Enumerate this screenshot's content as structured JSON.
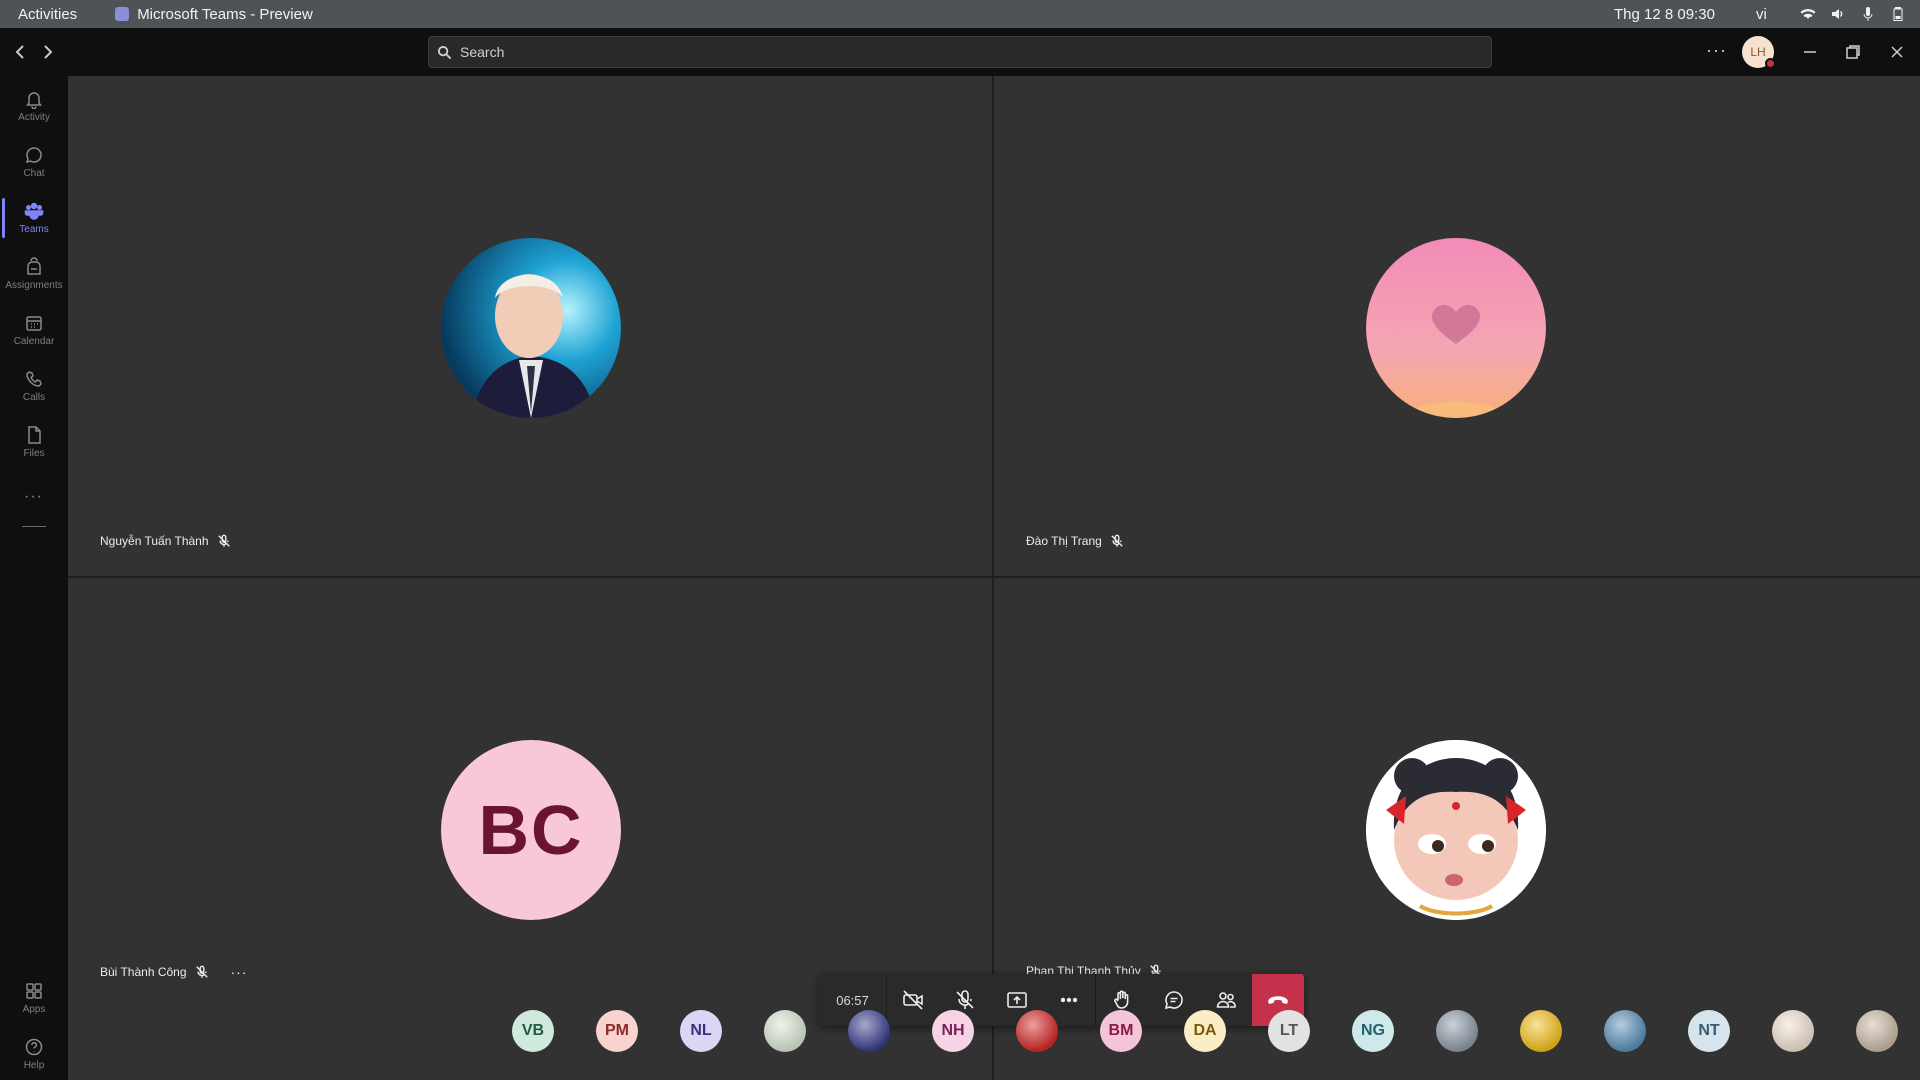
{
  "system_bar": {
    "activities": "Activities",
    "app_title": "Microsoft Teams - Preview",
    "clock": "Thg 12 8  09:30",
    "language": "vi"
  },
  "titlebar": {
    "search_placeholder": "Search",
    "more": "···",
    "avatar_initials": "LH"
  },
  "rail": {
    "items": [
      {
        "label": "Activity",
        "icon": "bell-icon"
      },
      {
        "label": "Chat",
        "icon": "chat-icon"
      },
      {
        "label": "Teams",
        "icon": "teams-icon",
        "active": true
      },
      {
        "label": "Assignments",
        "icon": "backpack-icon"
      },
      {
        "label": "Calendar",
        "icon": "calendar-icon"
      },
      {
        "label": "Calls",
        "icon": "phone-icon"
      },
      {
        "label": "Files",
        "icon": "file-icon"
      }
    ],
    "more": "···",
    "bottom_items": [
      {
        "label": "Apps",
        "icon": "apps-icon"
      },
      {
        "label": "Help",
        "icon": "help-icon"
      }
    ]
  },
  "participants": [
    {
      "name": "Nguyễn Tuấn Thành",
      "muted": true,
      "avatar": "photo"
    },
    {
      "name": "Đào Thị Trang",
      "muted": true,
      "avatar": "photo"
    },
    {
      "name": "Bùi Thành Công",
      "muted": true,
      "avatar_initials": "BC",
      "more": "···"
    },
    {
      "name": "Phan Thị Thanh Thủy",
      "muted": true,
      "avatar": "photo"
    }
  ],
  "call_controls": {
    "timer": "06:57"
  },
  "strip": [
    {
      "initials": "VB",
      "bg": "#cfe9dd",
      "fg": "#1d5e44"
    },
    {
      "initials": "PM",
      "bg": "#f9d3cf",
      "fg": "#8a2b24"
    },
    {
      "initials": "NL",
      "bg": "#dcd5f3",
      "fg": "#3e2f7f"
    },
    {
      "initials": "",
      "bg": "#d9e6d3",
      "photo": true
    },
    {
      "initials": "",
      "bg": "#3a3f8e",
      "photo": true
    },
    {
      "initials": "NH",
      "bg": "#f7d3e8",
      "fg": "#7a1f55"
    },
    {
      "initials": "",
      "bg": "#d62a2a",
      "photo": true
    },
    {
      "initials": "BM",
      "bg": "#f4c4d8",
      "fg": "#8a1d46"
    },
    {
      "initials": "DA",
      "bg": "#fbeec4",
      "fg": "#7a5a0a"
    },
    {
      "initials": "LT",
      "bg": "#e2e2e2",
      "fg": "#555555"
    },
    {
      "initials": "NG",
      "bg": "#cfe9ea",
      "fg": "#1f6468"
    },
    {
      "initials": "",
      "bg": "#8e9aa8",
      "photo": true
    },
    {
      "initials": "",
      "bg": "#f3c01c",
      "photo": true
    },
    {
      "initials": "",
      "bg": "#5a8fb8",
      "photo": true
    },
    {
      "initials": "NT",
      "bg": "#d6e4ee",
      "fg": "#3b5a72"
    },
    {
      "initials": "",
      "bg": "#f0e0d0",
      "photo": true
    },
    {
      "initials": "",
      "bg": "#c9b9a6",
      "photo": true
    }
  ]
}
